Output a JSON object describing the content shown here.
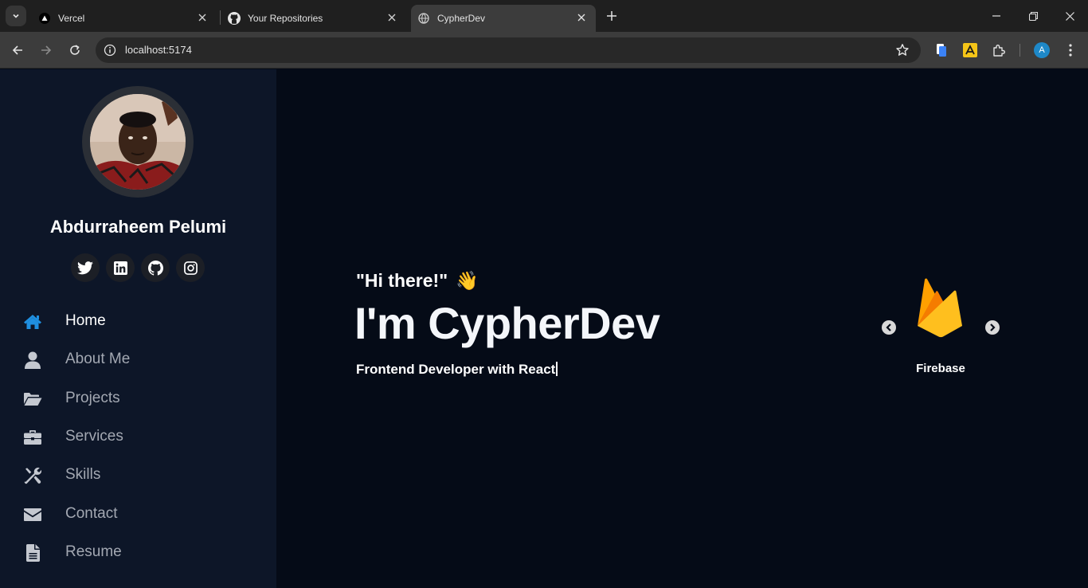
{
  "browser": {
    "tabs": [
      {
        "title": "Vercel",
        "icon": "vercel-icon"
      },
      {
        "title": "Your Repositories",
        "icon": "github-icon"
      },
      {
        "title": "CypherDev",
        "icon": "globe-icon",
        "active": true
      }
    ],
    "url": "localhost:5174",
    "profile_initial": "A"
  },
  "sidebar": {
    "name": "Abdurraheem Pelumi",
    "socials": [
      "twitter-icon",
      "linkedin-icon",
      "github-icon",
      "instagram-icon"
    ],
    "menu": [
      {
        "label": "Home",
        "icon": "home-icon",
        "active": true
      },
      {
        "label": "About Me",
        "icon": "user-icon"
      },
      {
        "label": "Projects",
        "icon": "folder-open-icon"
      },
      {
        "label": "Services",
        "icon": "briefcase-icon"
      },
      {
        "label": "Skills",
        "icon": "tools-icon"
      },
      {
        "label": "Contact",
        "icon": "envelope-icon"
      },
      {
        "label": "Resume",
        "icon": "file-icon"
      }
    ]
  },
  "hero": {
    "greeting": "\"Hi there!\"",
    "wave": "👋",
    "headline": "I'm CypherDev",
    "tagline": "Frontend Developer with React"
  },
  "carousel": {
    "current_label": "Firebase"
  },
  "colors": {
    "accent": "#1f8fe0",
    "sidebar_bg": "#0d1628",
    "main_bg": "#050b17"
  }
}
